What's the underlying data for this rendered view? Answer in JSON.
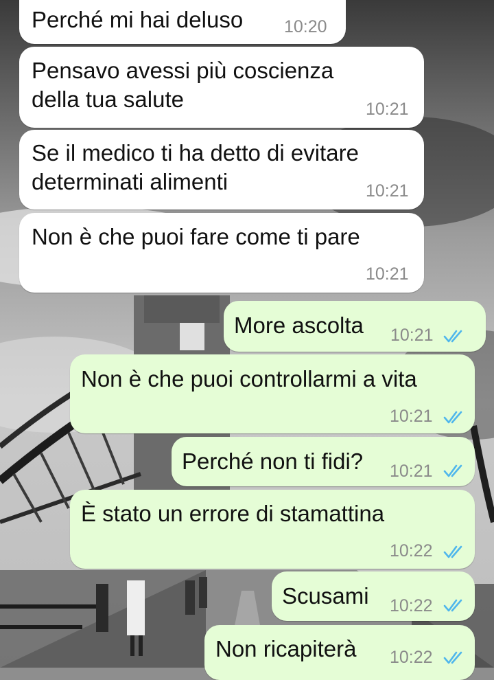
{
  "theme": {
    "incoming_bubble": "#ffffff",
    "outgoing_bubble": "#e5fdd6",
    "read_tick": "#4fb6ec",
    "timestamp": "#8a8a8a"
  },
  "messages": [
    {
      "direction": "incoming",
      "lines": [
        "Perché mi hai deluso"
      ],
      "time": "10:20"
    },
    {
      "direction": "incoming",
      "lines": [
        "Pensavo avessi più coscienza",
        "della tua salute"
      ],
      "time": "10:21"
    },
    {
      "direction": "incoming",
      "lines": [
        "Se il medico ti ha detto di evitare",
        "determinati alimenti"
      ],
      "time": "10:21"
    },
    {
      "direction": "incoming",
      "lines": [
        "Non è che puoi fare come ti pare"
      ],
      "time": "10:21"
    },
    {
      "direction": "outgoing",
      "lines": [
        "More ascolta"
      ],
      "time": "10:21",
      "status": "read-double-check-icon"
    },
    {
      "direction": "outgoing",
      "lines": [
        "Non è che puoi controllarmi a vita"
      ],
      "time": "10:21",
      "status": "read-double-check-icon"
    },
    {
      "direction": "outgoing",
      "lines": [
        "Perché non ti fidi?"
      ],
      "time": "10:21",
      "status": "read-double-check-icon"
    },
    {
      "direction": "outgoing",
      "lines": [
        "È stato un errore di stamattina"
      ],
      "time": "10:22",
      "status": "read-double-check-icon"
    },
    {
      "direction": "outgoing",
      "lines": [
        "Scusami"
      ],
      "time": "10:22",
      "status": "read-double-check-icon"
    },
    {
      "direction": "outgoing",
      "lines": [
        "Non ricapiterà"
      ],
      "time": "10:22",
      "status": "read-double-check-icon"
    }
  ]
}
